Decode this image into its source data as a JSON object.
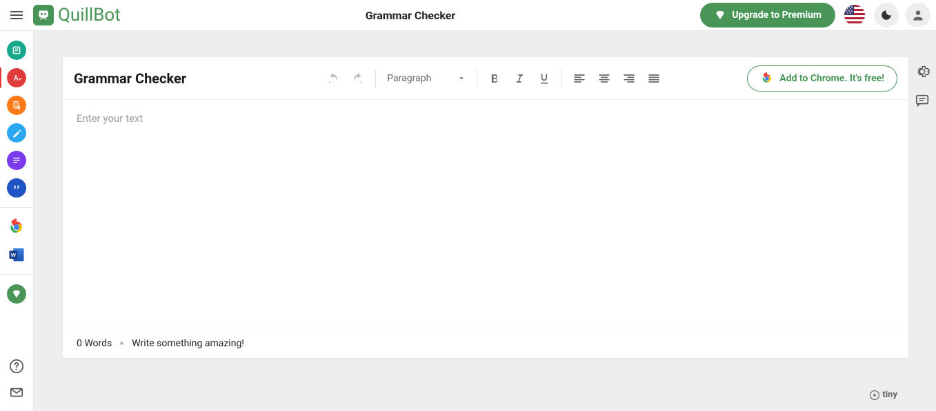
{
  "header": {
    "brand": "QuillBot",
    "title": "Grammar Checker",
    "premium_label": "Upgrade to Premium"
  },
  "sidebar": {
    "tools": [
      {
        "name": "paraphraser",
        "color": "#17a98c"
      },
      {
        "name": "grammar-checker",
        "color": "#e13c3c",
        "selected": true
      },
      {
        "name": "plagiarism-checker",
        "color": "#ff7a18"
      },
      {
        "name": "co-writer",
        "color": "#2aa7f0"
      },
      {
        "name": "summarizer",
        "color": "#7c3aed"
      },
      {
        "name": "citation-generator",
        "color": "#1f54c4"
      }
    ]
  },
  "editor": {
    "title": "Grammar Checker",
    "paragraph_label": "Paragraph",
    "chrome_cta": "Add to Chrome. It's free!",
    "placeholder": "Enter your text",
    "word_count": "0 Words",
    "footer_msg": "Write something amazing!"
  },
  "attribution": {
    "tiny": "tiny"
  }
}
